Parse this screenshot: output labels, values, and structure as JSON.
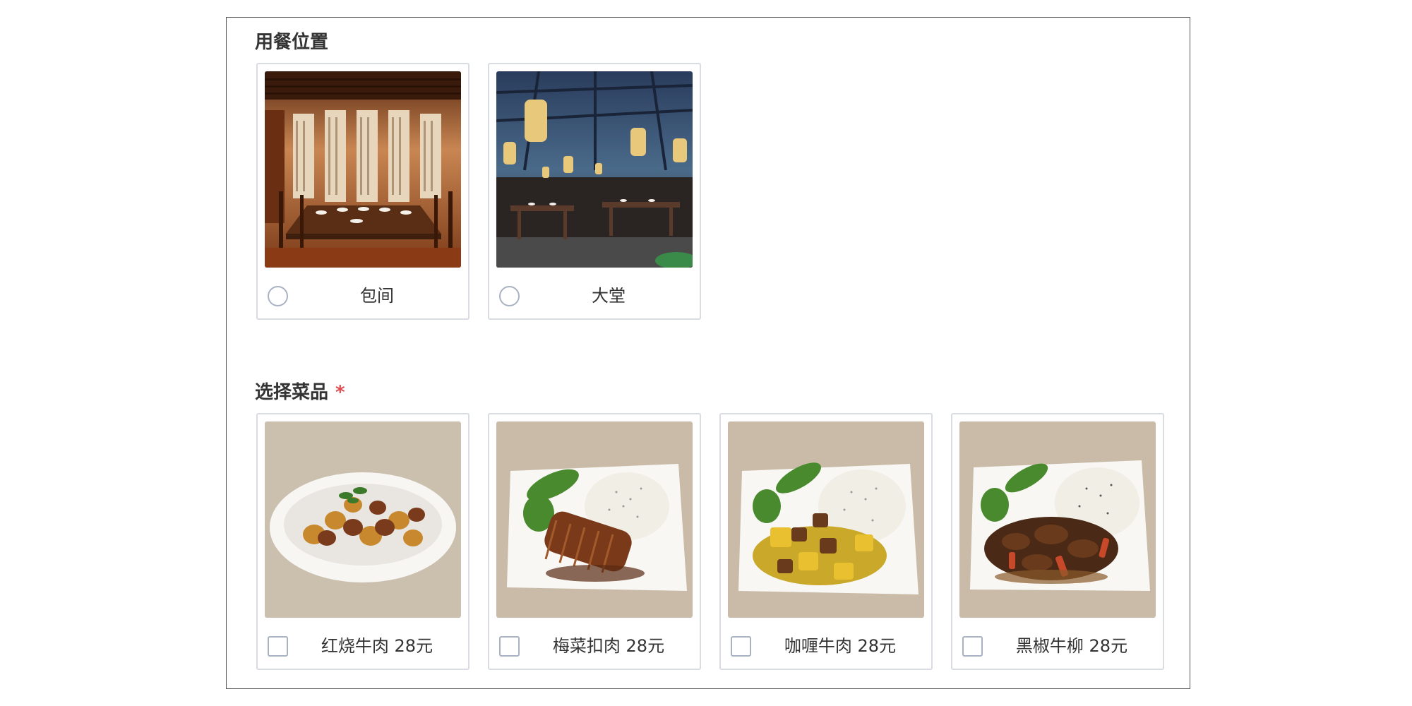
{
  "dining": {
    "title": "用餐位置",
    "options": [
      {
        "label": "包间",
        "image": "private-room-photo",
        "selected": false
      },
      {
        "label": "大堂",
        "image": "main-hall-photo",
        "selected": false
      }
    ]
  },
  "dishes": {
    "title": "选择菜品",
    "required_mark": "*",
    "options": [
      {
        "label": "红烧牛肉 28元",
        "image": "braised-beef-photo",
        "checked": false
      },
      {
        "label": "梅菜扣肉 28元",
        "image": "preserved-vegetable-pork-rice-photo",
        "checked": false
      },
      {
        "label": "咖喱牛肉 28元",
        "image": "curry-beef-rice-photo",
        "checked": false
      },
      {
        "label": "黑椒牛柳 28元",
        "image": "black-pepper-beef-rice-photo",
        "checked": false
      }
    ]
  },
  "colors": {
    "required": "#e5484d",
    "control_border": "#a9b2c3",
    "card_border": "#d9dde3",
    "panel_border": "#555555"
  }
}
